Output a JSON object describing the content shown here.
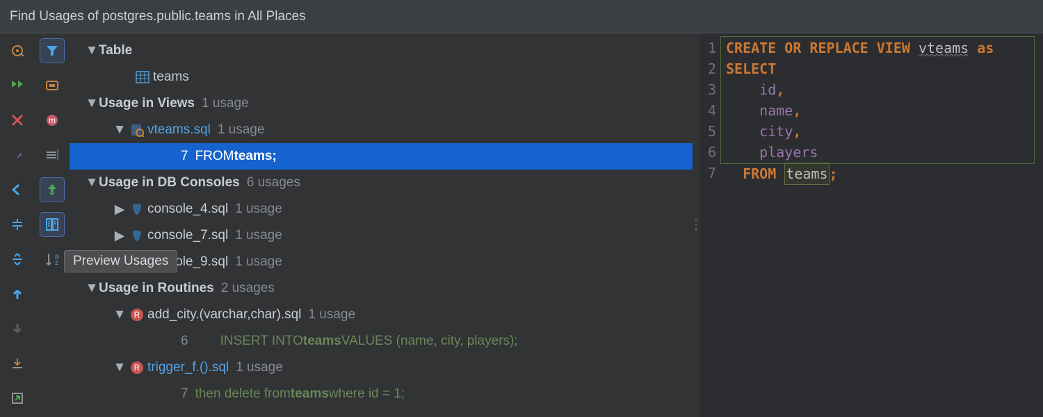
{
  "title": "Find Usages of postgres.public.teams in All Places",
  "tooltip": "Preview Usages",
  "tree": {
    "table_label": "Table",
    "table_name": "teams",
    "views_label": "Usage in Views",
    "views_count": "1 usage",
    "vteams_file": "vteams.sql",
    "vteams_count": "1 usage",
    "vteams_line": "7",
    "vteams_text1": "FROM ",
    "vteams_text2": "teams;",
    "db_label": "Usage in DB Consoles",
    "db_count": "6 usages",
    "c4": "console_4.sql",
    "c4_count": "1 usage",
    "c7": "console_7.sql",
    "c7_count": "1 usage",
    "c9": "console_9.sql",
    "c9_count": "1 usage",
    "routines_label": "Usage in Routines",
    "routines_count": "2 usages",
    "addcity_file": "add_city.(varchar,char).sql",
    "addcity_count": "1 usage",
    "addcity_line": "6",
    "addcity_t1": "INSERT INTO ",
    "addcity_t2": "teams",
    "addcity_t3": " VALUES (name, city, players);",
    "trigger_file": "trigger_f.().sql",
    "trigger_count": "1 usage",
    "trigger_line": "7",
    "trigger_t1": "then delete from ",
    "trigger_t2": "teams",
    "trigger_t3": " where id = 1;"
  },
  "editor": {
    "lines": [
      "1",
      "2",
      "3",
      "4",
      "5",
      "6",
      "7"
    ],
    "l1a": "CREATE OR REPLACE VIEW ",
    "l1b": "vteams",
    "l1c": " as",
    "l2": "SELECT",
    "l3": "id",
    "l4": "name",
    "l5": "city",
    "l6": "players",
    "l7a": "FROM",
    "l7b": "teams",
    "l7c": ";"
  }
}
